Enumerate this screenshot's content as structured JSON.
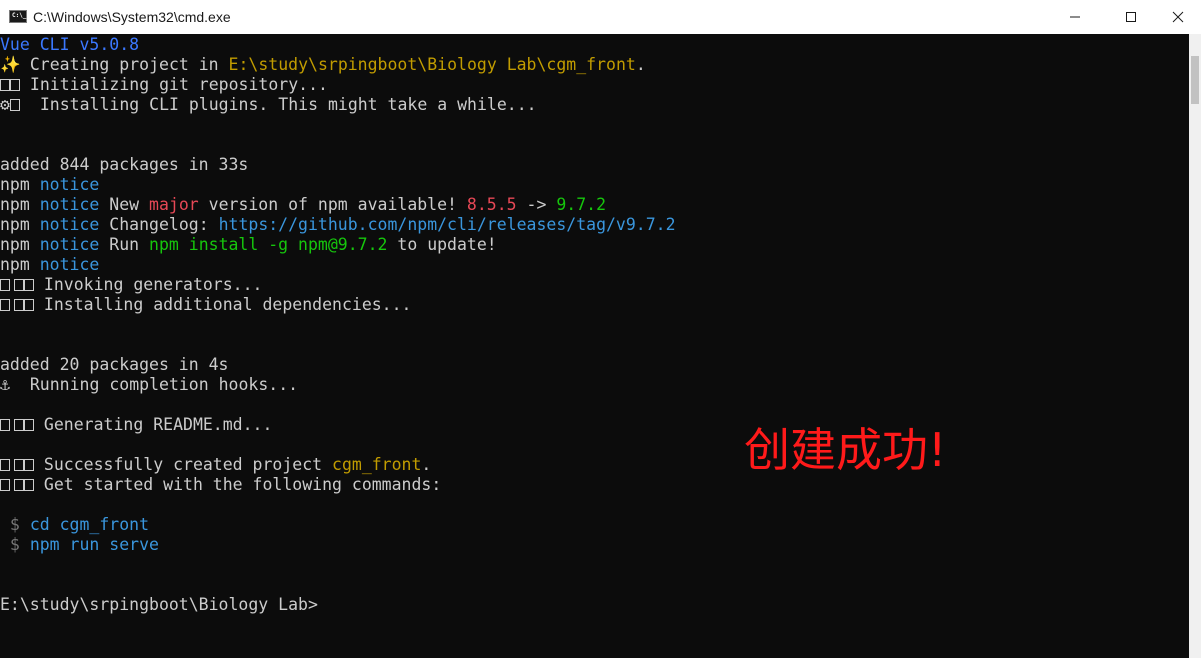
{
  "window": {
    "title": "C:\\Windows\\System32\\cmd.exe",
    "icon_glyph": "C:\\_"
  },
  "console": {
    "l1": "Vue CLI v5.0.8",
    "l2_sym": "✨",
    "l2a": "  Creating project in ",
    "l2b": "E:\\study\\srpingboot\\Biology Lab\\cgm_front",
    "l2c": ".",
    "l3": " Initializing git repository...",
    "l4_sym": "⚙",
    "l4": "  Installing CLI plugins. This might take a while...",
    "l5": "added 844 packages in 33s",
    "l6a": "npm ",
    "l6b": "notice",
    "l7a": "npm ",
    "l7b": "notice",
    "l7c": " New ",
    "l7d": "major",
    "l7e": " version of npm available! ",
    "l7f": "8.5.5",
    "l7g": " -> ",
    "l7h": "9.7.2",
    "l8a": "npm ",
    "l8b": "notice",
    "l8c": " Changelog: ",
    "l8d": "https://github.com/npm/cli/releases/tag/v9.7.2",
    "l9a": "npm ",
    "l9b": "notice",
    "l9c": " Run ",
    "l9d": "npm install -g npm@9.7.2",
    "l9e": " to update!",
    "l10a": "npm ",
    "l10b": "notice",
    "l11": " Invoking generators...",
    "l12": " Installing additional dependencies...",
    "l13": "added 20 packages in 4s",
    "l14_sym": "⚓",
    "l14": "  Running completion hooks...",
    "l15": " Generating README.md...",
    "l16a": " Successfully created project ",
    "l16b": "cgm_front",
    "l16c": ".",
    "l17": " Get started with the following commands:",
    "l18a": " $ ",
    "l18b": "cd cgm_front",
    "l19a": " $ ",
    "l19b": "npm run serve",
    "l20": "E:\\study\\srpingboot\\Biology Lab>"
  },
  "annotation": "创建成功!",
  "colors": {
    "background": "#0c0c0c",
    "default_text": "#cccccc",
    "blue": "#3b78ff",
    "light_blue": "#3a96dd",
    "yellow": "#c19c00",
    "red": "#e74856",
    "green": "#16c60c",
    "annotation": "#ff1a1a"
  }
}
